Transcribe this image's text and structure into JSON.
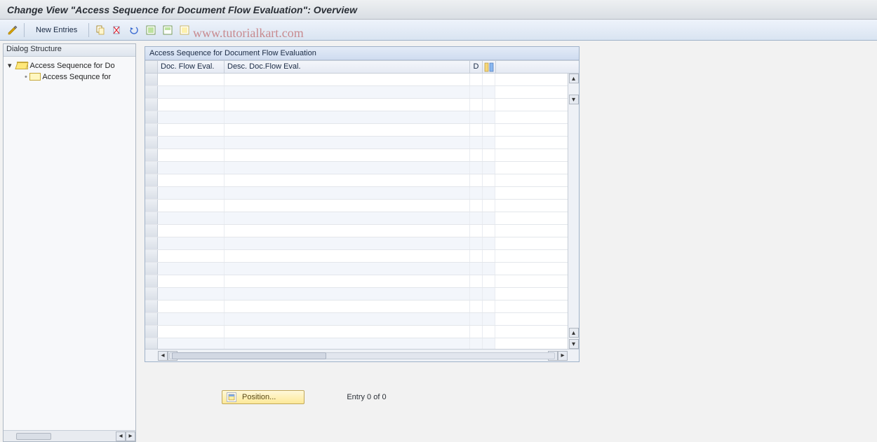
{
  "title": "Change View \"Access Sequence for Document Flow Evaluation\": Overview",
  "toolbar": {
    "display_change_icon": "display-change-icon",
    "new_entries_label": "New Entries",
    "copy_icon": "copy-icon",
    "delete_icon": "delete-icon",
    "undo_icon": "undo-icon",
    "select_all_icon": "select-all-icon",
    "select_block_icon": "select-block-icon",
    "deselect_all_icon": "deselect-all-icon"
  },
  "watermark": "www.tutorialkart.com",
  "sidebar": {
    "header": "Dialog Structure",
    "items": [
      {
        "label": "Access Sequence for Do",
        "open": true
      },
      {
        "label": "Access Sequnce for ",
        "open": false
      }
    ]
  },
  "panel": {
    "title": "Access Sequence for Document Flow Evaluation",
    "columns": {
      "c1": "Doc. Flow Eval.",
      "c2": "Desc. Doc.Flow Eval.",
      "c3": "D"
    },
    "row_count": 22
  },
  "footer": {
    "position_label": "Position...",
    "status": "Entry 0 of 0"
  }
}
